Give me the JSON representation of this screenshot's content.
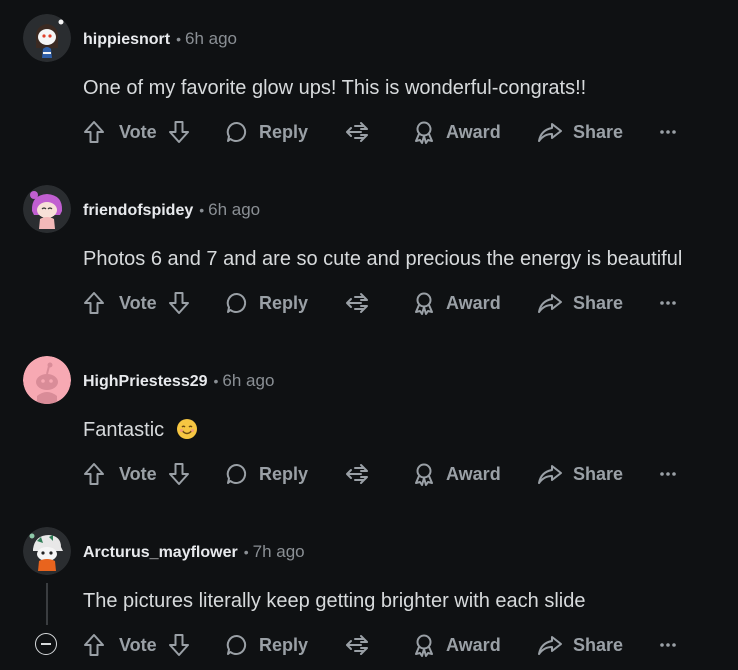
{
  "comments": [
    {
      "username": "hippiesnort",
      "time": "6h ago",
      "text": "One of my favorite glow ups! This is wonderful-congrats!!",
      "avatar": "snoo-dark-hair-avatar"
    },
    {
      "username": "friendofspidey",
      "time": "6h ago",
      "text": "Photos 6 and 7 and are so cute and precious the energy is beautiful",
      "avatar": "snoo-pink-hair-avatar"
    },
    {
      "username": "HighPriestess29",
      "time": "6h ago",
      "text": "Fantastic",
      "emoji": "smiling-face-emoji",
      "avatar": "default-snoo-pink-avatar"
    },
    {
      "username": "Arcturus_mayflower",
      "time": "7h ago",
      "text": "The pictures literally keep getting brighter with each slide",
      "avatar": "snoo-dino-hat-avatar"
    }
  ],
  "actions": {
    "vote": "Vote",
    "reply": "Reply",
    "award": "Award",
    "share": "Share",
    "more": "more-options-icon"
  },
  "separator": "•",
  "colors": {
    "background": "#0f1113",
    "text": "#d7dadc",
    "muted": "#9aa0a6"
  }
}
